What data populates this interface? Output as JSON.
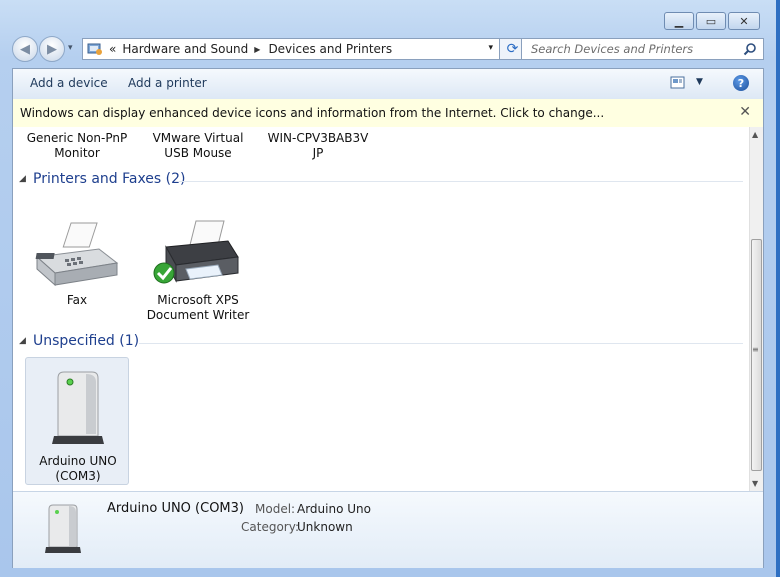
{
  "window": {
    "minimize_glyph": "▁",
    "maximize_glyph": "▭",
    "close_glyph": "✕"
  },
  "nav": {
    "back_glyph": "◀",
    "forward_glyph": "▶",
    "history_glyph": "▾",
    "breadcrumbs": [
      "Hardware and Sound",
      "Devices and Printers"
    ],
    "overflow_glyph": "«",
    "separator_glyph": "▶",
    "refresh_glyph": "⟳",
    "search_placeholder": "Search Devices and Printers"
  },
  "toolbar": {
    "add_device": "Add a device",
    "add_printer": "Add a printer",
    "view_drop_glyph": "▼",
    "help_glyph": "?"
  },
  "infobar": {
    "message": "Windows can display enhanced device icons and information from the Internet. Click to change...",
    "close_glyph": "✕"
  },
  "devices_top": [
    {
      "line1": "Generic Non-PnP",
      "line2": "Monitor"
    },
    {
      "line1": "VMware Virtual",
      "line2": "USB Mouse"
    },
    {
      "line1": "WIN-CPV3BAB3V",
      "line2": "JP"
    }
  ],
  "groups": {
    "printers": {
      "title": "Printers and Faxes (2)",
      "items": [
        {
          "line1": "Fax",
          "line2": ""
        },
        {
          "line1": "Microsoft XPS",
          "line2": "Document Writer"
        }
      ]
    },
    "unspecified": {
      "title": "Unspecified (1)",
      "items": [
        {
          "line1": "Arduino UNO",
          "line2": "(COM3)"
        }
      ]
    }
  },
  "details": {
    "name": "Arduino UNO (COM3)",
    "model_label": "Model:",
    "model_value": "Arduino Uno",
    "category_label": "Category:",
    "category_value": "Unknown"
  },
  "scrollbar": {
    "up_glyph": "▲",
    "down_glyph": "▼",
    "grip_glyph": "≡"
  }
}
